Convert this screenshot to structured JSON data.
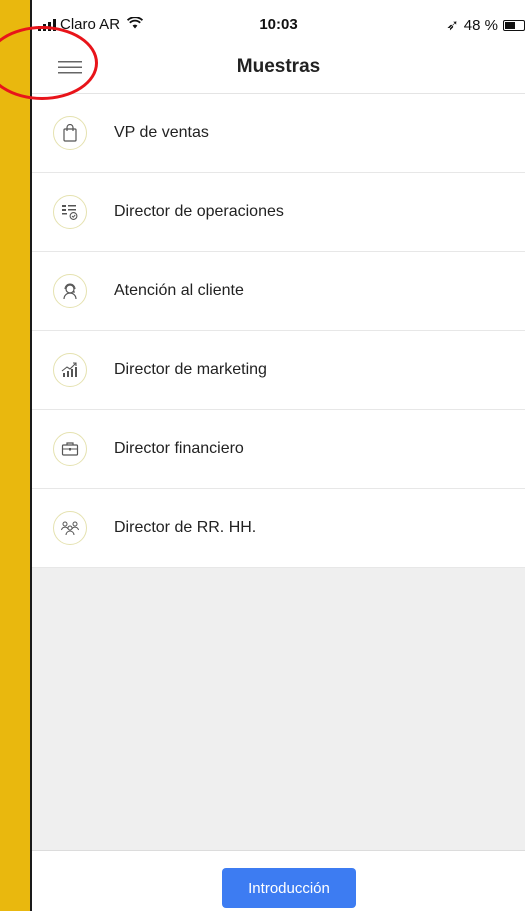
{
  "status_bar": {
    "carrier": "Claro AR",
    "time": "10:03",
    "battery": "48 %",
    "location_glyph": "➶"
  },
  "nav": {
    "title": "Muestras",
    "menu_icon": "hamburger-menu-icon"
  },
  "items": [
    {
      "label": "VP de ventas",
      "icon": "shopping-bag-icon"
    },
    {
      "label": "Director de operaciones",
      "icon": "checklist-icon"
    },
    {
      "label": "Atención al cliente",
      "icon": "headset-icon"
    },
    {
      "label": "Director de marketing",
      "icon": "growth-chart-icon"
    },
    {
      "label": "Director financiero",
      "icon": "briefcase-icon"
    },
    {
      "label": "Director de RR. HH.",
      "icon": "team-icon"
    }
  ],
  "footer": {
    "button_label": "Introducción"
  },
  "colors": {
    "accent": "#3d7cf2",
    "annotation": "#e8141a",
    "frame": "#E9B80E"
  }
}
